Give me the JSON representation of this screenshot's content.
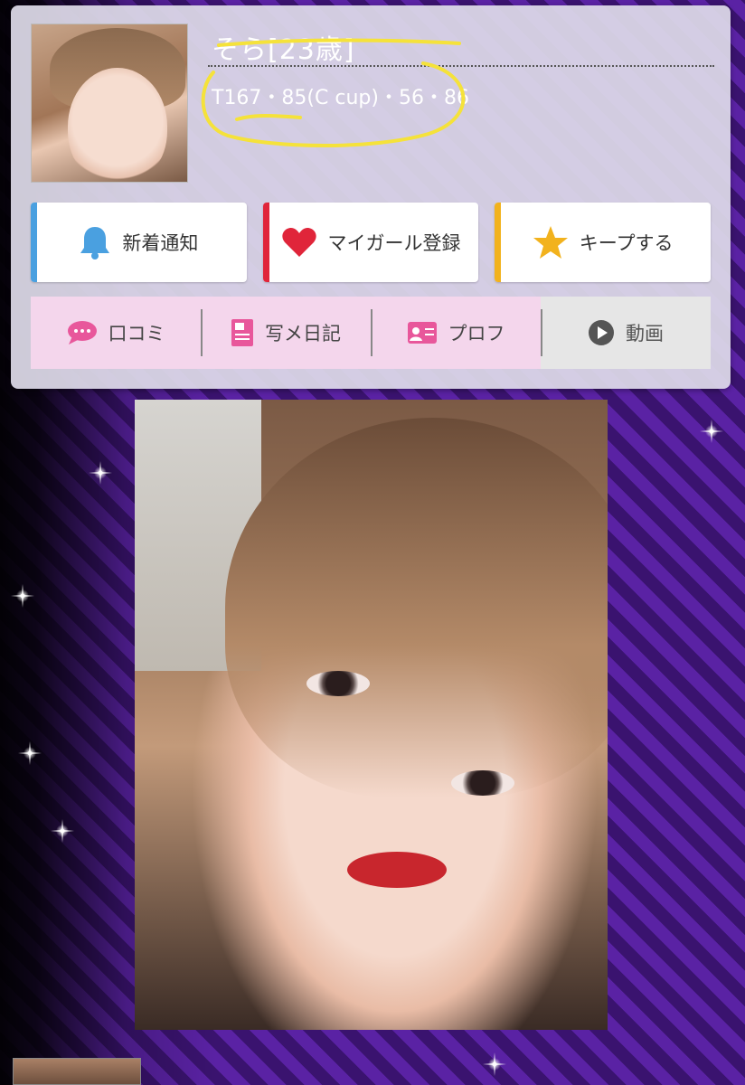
{
  "profile": {
    "name": "そら[23歳]",
    "stats": "T167・85(C cup)・56・86"
  },
  "actions": [
    {
      "label": "新着通知",
      "icon": "bell-icon",
      "color": "#4aa0e0"
    },
    {
      "label": "マイガール登録",
      "icon": "heart-icon",
      "color": "#e0253a"
    },
    {
      "label": "キープする",
      "icon": "star-icon",
      "color": "#f2b21d"
    }
  ],
  "tabs": [
    {
      "label": "口コミ",
      "icon": "speech-bubble-icon"
    },
    {
      "label": "写メ日記",
      "icon": "diary-icon"
    },
    {
      "label": "プロフ",
      "icon": "profile-card-icon"
    },
    {
      "label": "動画",
      "icon": "play-icon"
    }
  ],
  "colors": {
    "accent_pink": "#e8579b",
    "scribble": "#f5e23a"
  }
}
